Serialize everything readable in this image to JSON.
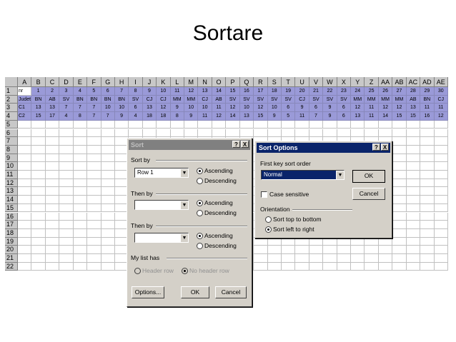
{
  "slide": {
    "title": "Sortare"
  },
  "sheet": {
    "columns": [
      "A",
      "B",
      "C",
      "D",
      "E",
      "F",
      "G",
      "H",
      "I",
      "J",
      "K",
      "L",
      "M",
      "N",
      "O",
      "P",
      "Q",
      "R",
      "S",
      "T",
      "U",
      "V",
      "W",
      "X",
      "Y",
      "Z",
      "AA",
      "AB",
      "AC",
      "AD",
      "AE"
    ],
    "row_numbers": [
      "1",
      "2",
      "3",
      "4",
      "5",
      "6",
      "7",
      "8",
      "9",
      "10",
      "11",
      "12",
      "13",
      "14",
      "15",
      "16",
      "17",
      "18",
      "19",
      "20",
      "21",
      "22"
    ],
    "rows": [
      [
        "nr",
        "1",
        "2",
        "3",
        "4",
        "5",
        "6",
        "7",
        "8",
        "9",
        "10",
        "11",
        "12",
        "13",
        "14",
        "15",
        "16",
        "17",
        "18",
        "19",
        "20",
        "21",
        "22",
        "23",
        "24",
        "25",
        "26",
        "27",
        "28",
        "29",
        "30"
      ],
      [
        "Judet",
        "BN",
        "AB",
        "SV",
        "BN",
        "BN",
        "BN",
        "BN",
        "SV",
        "CJ",
        "CJ",
        "MM",
        "MM",
        "CJ",
        "AB",
        "SV",
        "SV",
        "SV",
        "SV",
        "SV",
        "CJ",
        "SV",
        "SV",
        "SV",
        "MM",
        "MM",
        "MM",
        "MM",
        "AB",
        "BN",
        "CJ"
      ],
      [
        "C1",
        "13",
        "13",
        "7",
        "7",
        "7",
        "10",
        "10",
        "6",
        "13",
        "12",
        "9",
        "10",
        "10",
        "11",
        "12",
        "10",
        "12",
        "10",
        "6",
        "9",
        "6",
        "9",
        "6",
        "12",
        "11",
        "12",
        "12",
        "13",
        "11",
        "11"
      ],
      [
        "C2",
        "15",
        "17",
        "4",
        "8",
        "7",
        "7",
        "9",
        "4",
        "18",
        "18",
        "8",
        "9",
        "11",
        "12",
        "14",
        "13",
        "15",
        "9",
        "5",
        "11",
        "7",
        "9",
        "6",
        "13",
        "11",
        "14",
        "15",
        "15",
        "16",
        "12"
      ]
    ]
  },
  "sort_dialog": {
    "title": "Sort",
    "help_btn": "?",
    "close_btn": "X",
    "sort_by_label": "Sort by",
    "sort_by_value": "Row 1",
    "then_by_label_1": "Then by",
    "then_by_label_2": "Then by",
    "then_by_value_1": "",
    "then_by_value_2": "",
    "ascending": "Ascending",
    "descending": "Descending",
    "my_list_has": "My list has",
    "header_row": "Header row",
    "no_header_row": "No header row",
    "options_btn": "Options...",
    "ok_btn": "OK",
    "cancel_btn": "Cancel",
    "dropdown_icon": "chevron-down-icon"
  },
  "sort_options_dialog": {
    "title": "Sort Options",
    "help_btn": "?",
    "close_btn": "X",
    "first_key_label": "First key sort order",
    "first_key_value": "Normal",
    "ok_btn": "OK",
    "cancel_btn": "Cancel",
    "case_sensitive": "Case sensitive",
    "orientation_label": "Orientation",
    "top_to_bottom": "Sort top to bottom",
    "left_to_right": "Sort left to right"
  },
  "colors": {
    "selection": "#9a9ad8",
    "dialog": "#d4d0c8",
    "active_title": "#0a246a",
    "inactive_title": "#808080"
  }
}
